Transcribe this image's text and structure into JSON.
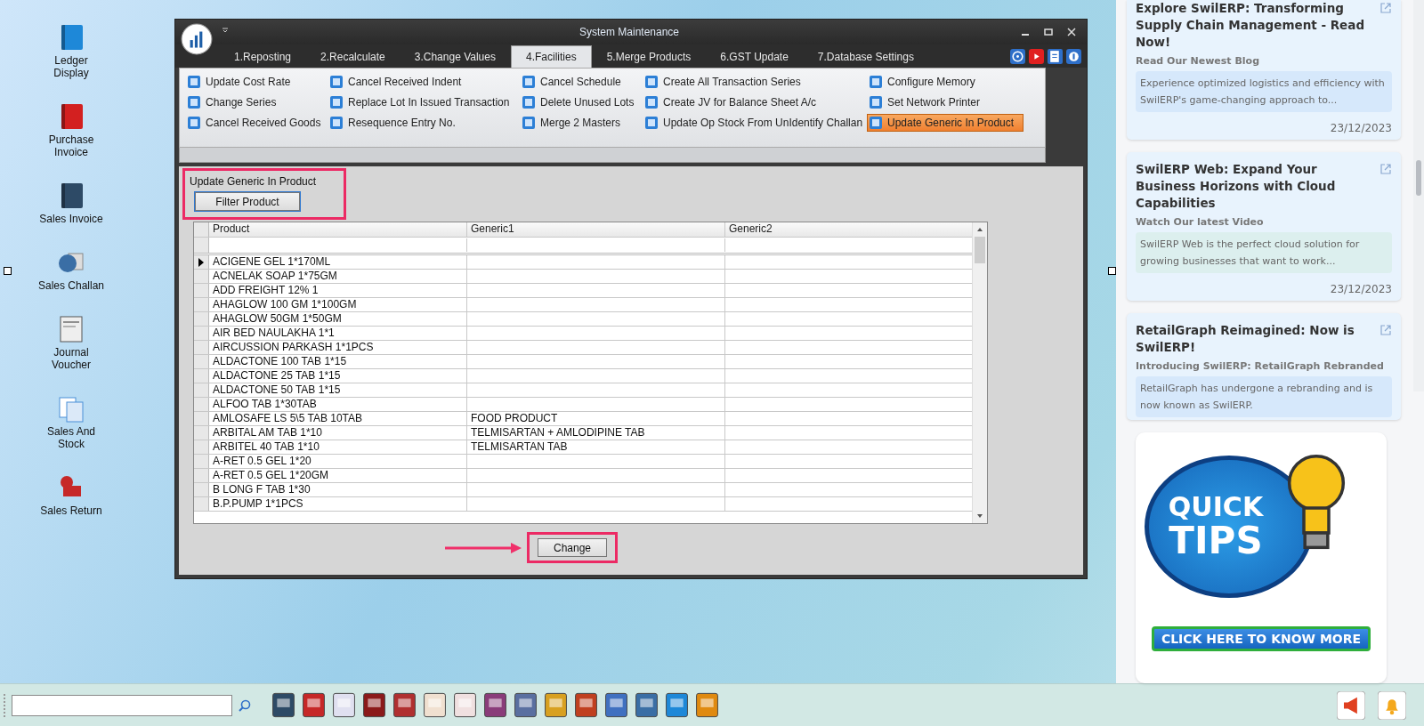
{
  "desktop_icons": [
    {
      "label": "Ledger Display",
      "kind": "ledger"
    },
    {
      "label": "Purchase Invoice",
      "kind": "purchase"
    },
    {
      "label": "Sales Invoice",
      "kind": "sales"
    },
    {
      "label": "Sales Challan",
      "kind": "challan"
    },
    {
      "label": "Journal Voucher",
      "kind": "journal"
    },
    {
      "label": "Sales And Stock",
      "kind": "stock"
    },
    {
      "label": "Sales Return",
      "kind": "return"
    }
  ],
  "window": {
    "title": "System Maintenance",
    "tabs": [
      {
        "label": "1.Reposting",
        "selected": false
      },
      {
        "label": "2.Recalculate",
        "selected": false
      },
      {
        "label": "3.Change Values",
        "selected": false
      },
      {
        "label": "4.Facilities",
        "selected": true
      },
      {
        "label": "5.Merge Products",
        "selected": false
      },
      {
        "label": "6.GST Update",
        "selected": false
      },
      {
        "label": "7.Database Settings",
        "selected": false
      }
    ],
    "ribbon_items": [
      {
        "label": "Update Cost Rate",
        "selected": false
      },
      {
        "label": "Cancel Received Indent",
        "selected": false
      },
      {
        "label": "Cancel Schedule",
        "selected": false
      },
      {
        "label": "Create All Transaction Series",
        "selected": false
      },
      {
        "label": "Configure Memory",
        "selected": false
      },
      {
        "label": "Change Series",
        "selected": false
      },
      {
        "label": "Replace Lot In Issued Transaction",
        "selected": false
      },
      {
        "label": "Delete Unused Lots",
        "selected": false
      },
      {
        "label": "Create JV for Balance Sheet A/c",
        "selected": false
      },
      {
        "label": "Set Network Printer",
        "selected": false
      },
      {
        "label": "Cancel Received Goods",
        "selected": false
      },
      {
        "label": "Resequence Entry No.",
        "selected": false
      },
      {
        "label": "Merge 2 Masters",
        "selected": false
      },
      {
        "label": "Update Op Stock From UnIdentify Challan",
        "selected": false
      },
      {
        "label": "Update Generic In Product",
        "selected": true
      }
    ],
    "section_title": "Update Generic In Product",
    "filter_button": "Filter Product",
    "table": {
      "columns": [
        "Product",
        "Generic1",
        "Generic2"
      ],
      "rows": [
        {
          "product": "ACIGENE GEL 1*170ML",
          "generic1": "",
          "generic2": "",
          "selected": true
        },
        {
          "product": "ACNELAK SOAP 1*75GM",
          "generic1": "",
          "generic2": "",
          "selected": false
        },
        {
          "product": "ADD FREIGHT 12% 1",
          "generic1": "",
          "generic2": "",
          "selected": false
        },
        {
          "product": "AHAGLOW 100 GM 1*100GM",
          "generic1": "",
          "generic2": "",
          "selected": false
        },
        {
          "product": "AHAGLOW 50GM 1*50GM",
          "generic1": "",
          "generic2": "",
          "selected": false
        },
        {
          "product": "AIR BED NAULAKHA 1*1",
          "generic1": "",
          "generic2": "",
          "selected": false
        },
        {
          "product": "AIRCUSSION PARKASH 1*1PCS",
          "generic1": "",
          "generic2": "",
          "selected": false
        },
        {
          "product": "ALDACTONE 100 TAB 1*15",
          "generic1": "",
          "generic2": "",
          "selected": false
        },
        {
          "product": "ALDACTONE 25 TAB 1*15",
          "generic1": "",
          "generic2": "",
          "selected": false
        },
        {
          "product": "ALDACTONE 50 TAB 1*15",
          "generic1": "",
          "generic2": "",
          "selected": false
        },
        {
          "product": "ALFOO TAB 1*30TAB",
          "generic1": "",
          "generic2": "",
          "selected": false
        },
        {
          "product": "AMLOSAFE LS 5\\5 TAB 10TAB",
          "generic1": "FOOD PRODUCT",
          "generic2": "",
          "selected": false
        },
        {
          "product": "ARBITAL AM TAB 1*10",
          "generic1": "TELMISARTAN + AMLODIPINE TAB",
          "generic2": "",
          "selected": false
        },
        {
          "product": "ARBITEL 40 TAB 1*10",
          "generic1": "TELMISARTAN TAB",
          "generic2": "",
          "selected": false
        },
        {
          "product": "A-RET 0.5 GEL 1*20",
          "generic1": "",
          "generic2": "",
          "selected": false
        },
        {
          "product": "A-RET 0.5 GEL 1*20GM",
          "generic1": "",
          "generic2": "",
          "selected": false
        },
        {
          "product": "B LONG F TAB 1*30",
          "generic1": "",
          "generic2": "",
          "selected": false
        },
        {
          "product": "B.P.PUMP 1*1PCS",
          "generic1": "",
          "generic2": "",
          "selected": false
        }
      ]
    },
    "change_button": "Change"
  },
  "news_cards": [
    {
      "title": "Explore SwilERP: Transforming Supply Chain Management - Read Now!",
      "subtitle": "Read Our Newest Blog",
      "excerpt": "Experience optimized logistics and efficiency with SwilERP's game-changing approach to...",
      "date": "23/12/2023"
    },
    {
      "title": "SwilERP Web: Expand Your Business Horizons with Cloud Capabilities",
      "subtitle": "Watch Our latest Video",
      "excerpt": "SwilERP Web is the perfect cloud solution for growing businesses that want to work...",
      "date": "23/12/2023"
    },
    {
      "title": "RetailGraph Reimagined: Now is SwilERP!",
      "subtitle": "Introducing SwilERP: RetailGraph Rebranded",
      "excerpt": "RetailGraph has undergone a rebranding and is now known as SwilERP."
    }
  ],
  "quick_tips": {
    "line1": "QUICK",
    "line2": "TIPS",
    "button": "CLICK HERE TO KNOW MORE"
  }
}
